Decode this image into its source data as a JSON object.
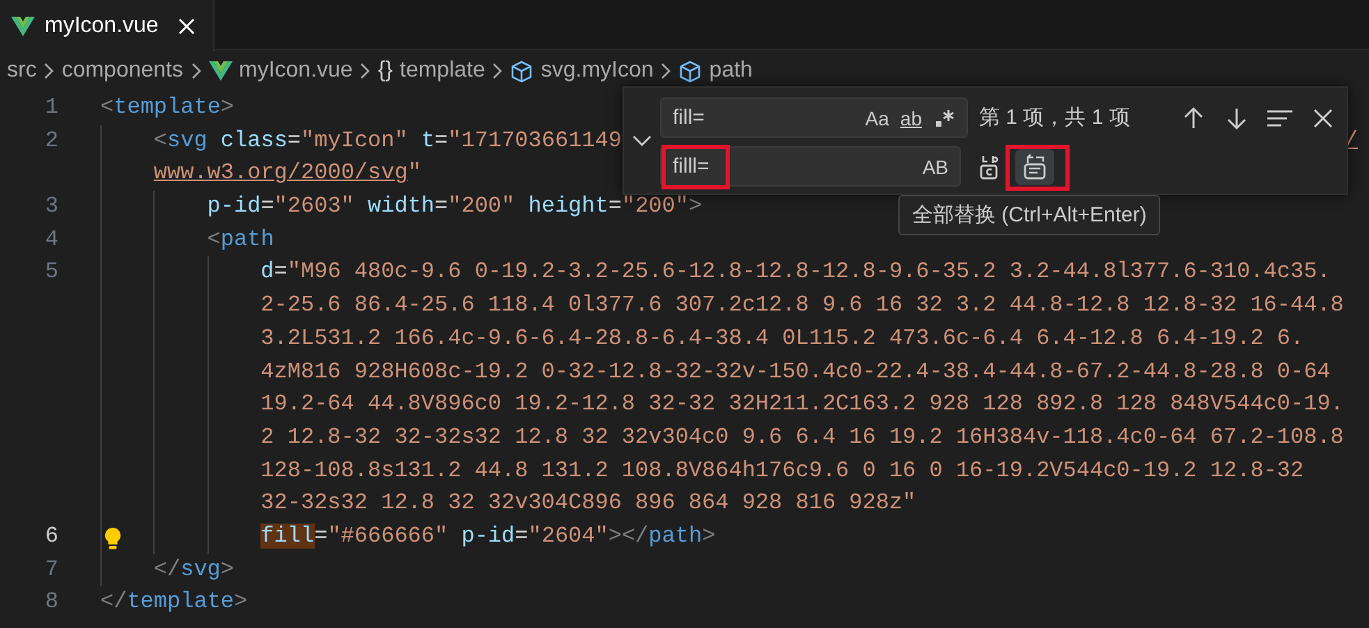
{
  "tabs": [
    {
      "label": "myIcon.vue",
      "kind": "vue",
      "selected": true
    }
  ],
  "breadcrumbs": [
    {
      "kind": "folder",
      "label": "src"
    },
    {
      "kind": "folder",
      "label": "components"
    },
    {
      "kind": "vue",
      "label": "myIcon.vue"
    },
    {
      "kind": "namespace",
      "icon": "{}",
      "label": "template"
    },
    {
      "kind": "element",
      "label": "svg.myIcon"
    },
    {
      "kind": "element",
      "label": "path"
    }
  ],
  "code_lines": [
    {
      "number": "1",
      "current": false,
      "rows": [
        {
          "tokens": [
            {
              "text": "<",
              "kind": "punct"
            },
            {
              "text": "template",
              "kind": "tag"
            },
            {
              "text": ">",
              "kind": "punct"
            }
          ]
        }
      ],
      "children": [
        {
          "number": "2",
          "current": false,
          "rows": [
            {
              "tokens": [
                {
                  "text": "<",
                  "kind": "punct"
                },
                {
                  "text": "svg",
                  "kind": "tag"
                },
                {
                  "text": " class",
                  "kind": "attr"
                },
                {
                  "text": "=",
                  "kind": "eq"
                },
                {
                  "text": "\"myIcon\"",
                  "kind": "str"
                },
                {
                  "text": " t",
                  "kind": "attr"
                },
                {
                  "text": "=",
                  "kind": "eq"
                },
                {
                  "text": "\"171703661149",
                  "kind": "str"
                }
              ]
            },
            {
              "tokens": [
                {
                  "text": "www.w3.org/2000/svg",
                  "kind": "link"
                },
                {
                  "text": "\"",
                  "kind": "str"
                }
              ]
            }
          ],
          "trailing": [
            {
              "text": "/",
              "kind": "link"
            }
          ],
          "children": [
            {
              "number": "3",
              "current": false,
              "rows": [
                {
                  "tokens": [
                    {
                      "text": "p-id",
                      "kind": "attr"
                    },
                    {
                      "text": "=",
                      "kind": "eq"
                    },
                    {
                      "text": "\"2603\"",
                      "kind": "str"
                    },
                    {
                      "text": " width",
                      "kind": "attr"
                    },
                    {
                      "text": "=",
                      "kind": "eq"
                    },
                    {
                      "text": "\"200\"",
                      "kind": "str"
                    },
                    {
                      "text": " height",
                      "kind": "attr"
                    },
                    {
                      "text": "=",
                      "kind": "eq"
                    },
                    {
                      "text": "\"200\"",
                      "kind": "str"
                    },
                    {
                      "text": ">",
                      "kind": "punct"
                    }
                  ]
                }
              ]
            },
            {
              "number": "4",
              "current": false,
              "rows": [
                {
                  "tokens": [
                    {
                      "text": "<",
                      "kind": "punct"
                    },
                    {
                      "text": "path",
                      "kind": "tag"
                    }
                  ]
                }
              ],
              "children": [
                {
                  "number": "5",
                  "current": false,
                  "rows": [
                    {
                      "tokens": [
                        {
                          "text": "d",
                          "kind": "attr"
                        },
                        {
                          "text": "=",
                          "kind": "eq"
                        },
                        {
                          "text": "\"M96 480c-9.6 0-19.2-3.2-25.6-12.8-12.8-12.8-9.6-35.2 3.2-44.8l377.6-310.4c35.",
                          "kind": "str"
                        }
                      ]
                    },
                    {
                      "tokens": [
                        {
                          "text": "2-25.6 86.4-25.6 118.4 0l377.6 307.2c12.8 9.6 16 32 3.2 44.8-12.8 12.8-32 16-44.8",
                          "kind": "str"
                        }
                      ]
                    },
                    {
                      "tokens": [
                        {
                          "text": "3.2L531.2 166.4c-9.6-6.4-28.8-6.4-38.4 0L115.2 473.6c-6.4 6.4-12.8 6.4-19.2 6.",
                          "kind": "str"
                        }
                      ]
                    },
                    {
                      "tokens": [
                        {
                          "text": "4zM816 928H608c-19.2 0-32-12.8-32-32v-150.4c0-22.4-38.4-44.8-67.2-44.8-28.8 0-64",
                          "kind": "str"
                        }
                      ]
                    },
                    {
                      "tokens": [
                        {
                          "text": "19.2-64 44.8V896c0 19.2-12.8 32-32 32H211.2C163.2 928 128 892.8 128 848V544c0-19.",
                          "kind": "str"
                        }
                      ]
                    },
                    {
                      "tokens": [
                        {
                          "text": "2 12.8-32 32-32s32 12.8 32 32v304c0 9.6 6.4 16 19.2 16H384v-118.4c0-64 67.2-108.8",
                          "kind": "str"
                        }
                      ]
                    },
                    {
                      "tokens": [
                        {
                          "text": "128-108.8s131.2 44.8 131.2 108.8V864h176c9.6 0 16 0 16-19.2V544c0-19.2 12.8-32",
                          "kind": "str"
                        }
                      ]
                    },
                    {
                      "tokens": [
                        {
                          "text": "32-32s32 12.8 32 32v304C896 896 864 928 816 928z\"",
                          "kind": "str"
                        }
                      ]
                    }
                  ]
                },
                {
                  "number": "6",
                  "current": true,
                  "lightbulb": true,
                  "rows": [
                    {
                      "tokens": [
                        {
                          "text": "fill",
                          "kind": "match"
                        },
                        {
                          "text": "=",
                          "kind": "eq"
                        },
                        {
                          "text": "\"#666666\"",
                          "kind": "str"
                        },
                        {
                          "text": " p-id",
                          "kind": "attr"
                        },
                        {
                          "text": "=",
                          "kind": "eq"
                        },
                        {
                          "text": "\"2604\"",
                          "kind": "str"
                        },
                        {
                          "text": "></",
                          "kind": "punct"
                        },
                        {
                          "text": "path",
                          "kind": "tag"
                        },
                        {
                          "text": ">",
                          "kind": "punct"
                        }
                      ]
                    }
                  ]
                }
              ]
            }
          ]
        },
        {
          "number": "7",
          "current": false,
          "rows": [
            {
              "tokens": [
                {
                  "text": "</",
                  "kind": "punct"
                },
                {
                  "text": "svg",
                  "kind": "tag"
                },
                {
                  "text": ">",
                  "kind": "punct"
                }
              ]
            }
          ]
        }
      ]
    },
    {
      "number": "8",
      "current": false,
      "rows": [
        {
          "tokens": [
            {
              "text": "</",
              "kind": "punct"
            },
            {
              "text": "template",
              "kind": "tag"
            },
            {
              "text": ">",
              "kind": "punct"
            }
          ]
        }
      ]
    }
  ],
  "find_widget": {
    "expanded": true,
    "find": {
      "value": "fill=",
      "toggles": [
        {
          "kind": "case",
          "label": "Aa",
          "on": false
        },
        {
          "kind": "word",
          "label": "ab",
          "on": false
        },
        {
          "kind": "regex",
          "on": false
        }
      ]
    },
    "match_count": "第 1 项，共 1 项",
    "replace": {
      "value": "filll=",
      "toggles": [
        {
          "kind": "preserve-case",
          "label": "AB",
          "on": false
        }
      ]
    },
    "replace_all_hovered": true,
    "tooltip": "全部替换 (Ctrl+Alt+Enter)"
  }
}
